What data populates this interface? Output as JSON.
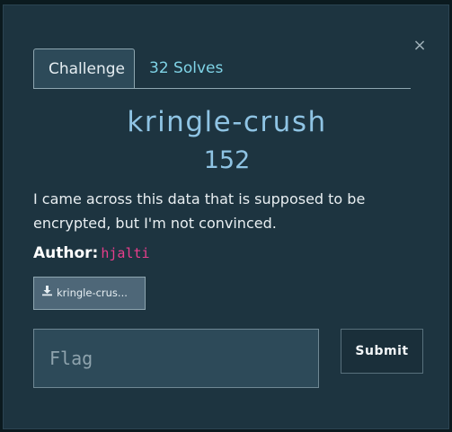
{
  "modal": {
    "close_label": "×",
    "tabs": [
      {
        "label": "Challenge",
        "active": true
      },
      {
        "label": "32 Solves",
        "active": false
      }
    ],
    "challenge": {
      "name": "kringle-crush",
      "points": "152",
      "description": "I came across this data that is supposed to be encrypted, but I'm not convinced.",
      "author_label": "Author:",
      "author_name": "hjalti",
      "file_label": "kringle-crus..."
    },
    "flag": {
      "value": "",
      "placeholder": "Flag"
    },
    "submit_label": "Submit"
  },
  "colors": {
    "modal_bg": "#1d3440",
    "title": "#8fc4e4",
    "author_name": "#e83e8c",
    "tab_link": "#7fd3e6"
  },
  "icons": {
    "close": "close-icon",
    "download": "download-icon"
  }
}
